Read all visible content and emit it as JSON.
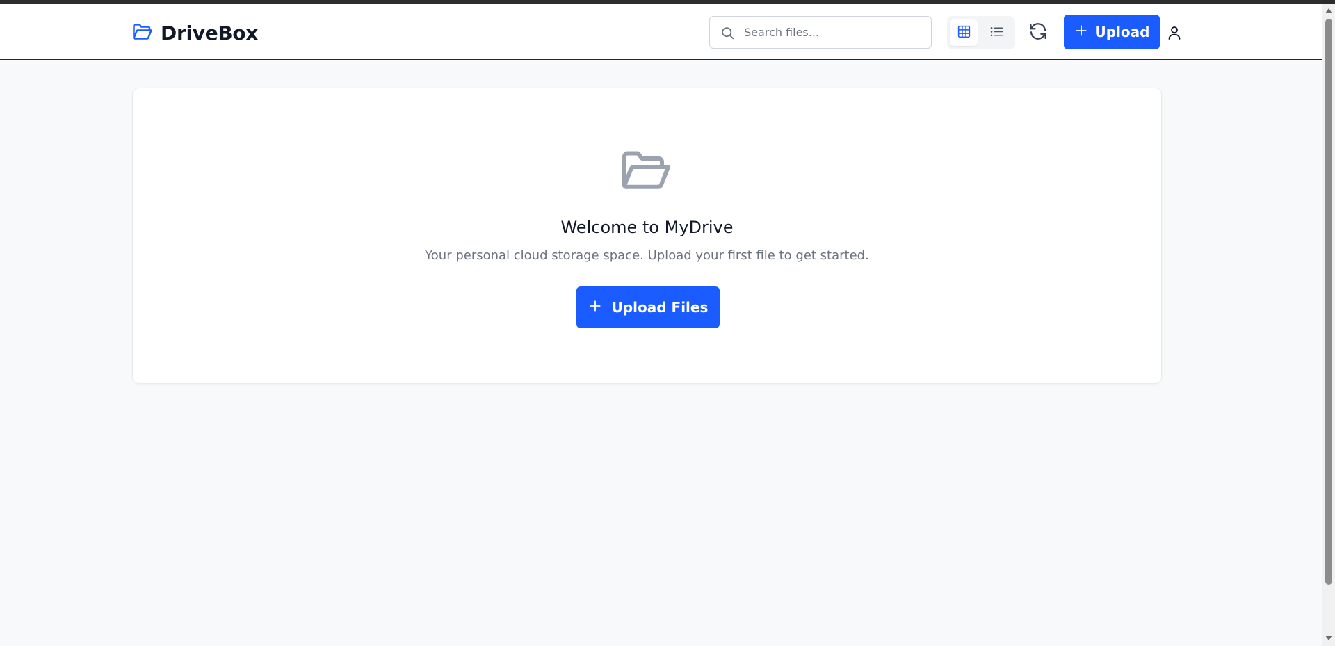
{
  "colors": {
    "accent": "#1a5cff",
    "header_bg": "#ffffff",
    "page_bg": "#f8f9fa",
    "muted_text": "#6b7280",
    "icon_gray": "#9ca3af"
  },
  "header": {
    "brand_icon": "folder-open-icon",
    "brand_name": "DriveBox",
    "search": {
      "icon": "search-icon",
      "placeholder": "Search files...",
      "value": ""
    },
    "view_toggle": {
      "active": "grid",
      "grid_icon": "grid-view-icon",
      "list_icon": "list-view-icon"
    },
    "refresh_icon": "refresh-icon",
    "upload_button": {
      "icon": "plus-icon",
      "label": "Upload"
    },
    "user_icon": "user-icon"
  },
  "empty_state": {
    "icon": "folder-open-icon",
    "title": "Welcome to MyDrive",
    "subtitle": "Your personal cloud storage space. Upload your first file to get started.",
    "button": {
      "icon": "plus-icon",
      "label": "Upload Files"
    }
  }
}
